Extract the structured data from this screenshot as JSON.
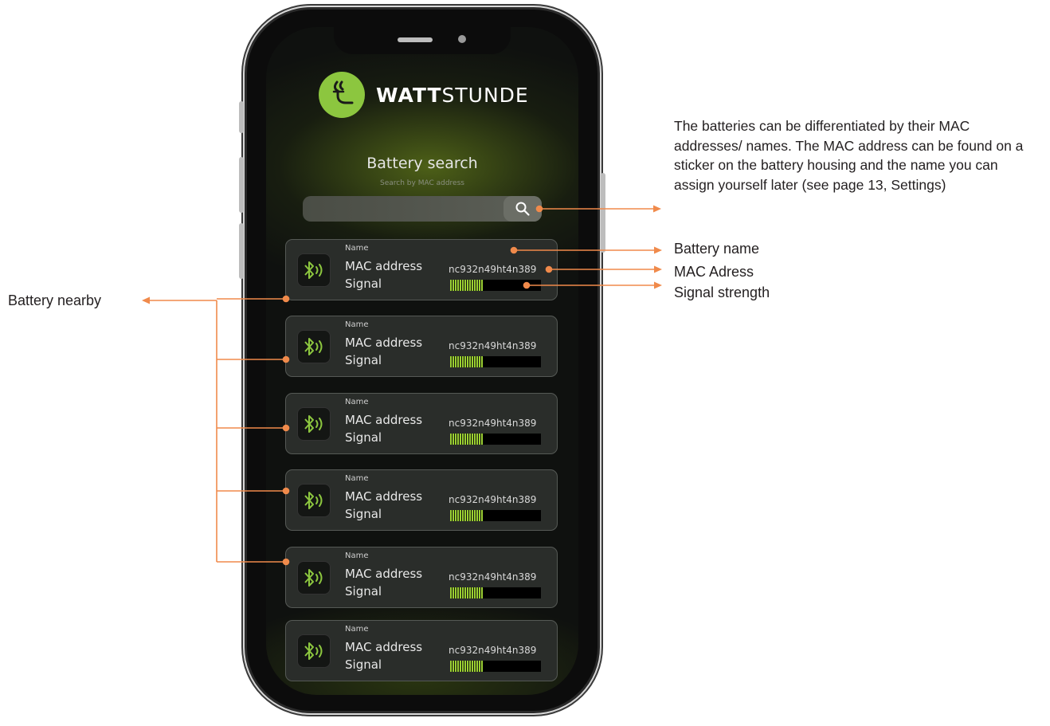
{
  "app": {
    "logo_bold": "WATT",
    "logo_rest": "STUNDE",
    "title": "Battery search",
    "subtitle": "Search by MAC address"
  },
  "search": {
    "value": "",
    "placeholder": "",
    "button_icon": "search-icon"
  },
  "batteries": [
    {
      "name_label": "Name",
      "mac_label": "MAC address",
      "signal_label": "Signal",
      "mac": "nc932n49ht4n389",
      "signal": 0.36,
      "icon": "bluetooth-icon"
    },
    {
      "name_label": "Name",
      "mac_label": "MAC address",
      "signal_label": "Signal",
      "mac": "nc932n49ht4n389",
      "signal": 0.36,
      "icon": "bluetooth-icon"
    },
    {
      "name_label": "Name",
      "mac_label": "MAC address",
      "signal_label": "Signal",
      "mac": "nc932n49ht4n389",
      "signal": 0.36,
      "icon": "bluetooth-icon"
    },
    {
      "name_label": "Name",
      "mac_label": "MAC address",
      "signal_label": "Signal",
      "mac": "nc932n49ht4n389",
      "signal": 0.36,
      "icon": "bluetooth-icon"
    },
    {
      "name_label": "Name",
      "mac_label": "MAC address",
      "signal_label": "Signal",
      "mac": "nc932n49ht4n389",
      "signal": 0.36,
      "icon": "bluetooth-icon"
    },
    {
      "name_label": "Name",
      "mac_label": "MAC address",
      "signal_label": "Signal",
      "mac": "nc932n49ht4n389",
      "signal": 0.36,
      "icon": "bluetooth-icon"
    }
  ],
  "annotations": {
    "search_description": "The batteries can be differentiated by their MAC addresses/ names. The MAC address can be found on a sticker on the battery housing and the name you can assign yourself later (see page 13, Settings)",
    "battery_name": "Battery name",
    "mac_address": "MAC Adress",
    "signal_strength": "Signal strength",
    "battery_nearby": "Battery nearby"
  },
  "colors": {
    "accent_green": "#8cc63f",
    "signal_green": "#9bd032",
    "annotation_orange": "#f08a4b",
    "annotation_text": "#231f20"
  }
}
